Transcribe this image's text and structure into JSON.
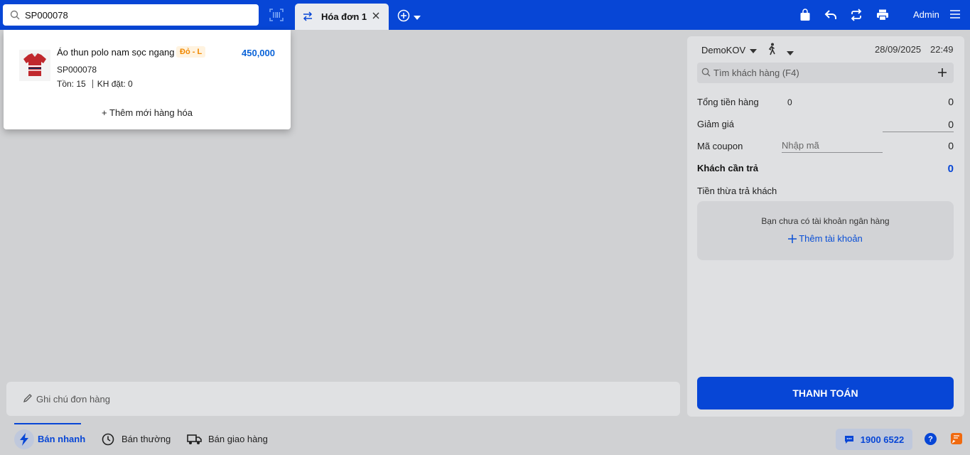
{
  "search": {
    "value": "SP000078"
  },
  "tabs": [
    {
      "label": "Hóa đơn 1"
    }
  ],
  "header": {
    "user": "Admin"
  },
  "dropdown": {
    "product": {
      "name": "Áo thun polo nam sọc ngang",
      "variant": "Đỏ - L",
      "price": "450,000",
      "sku": "SP000078",
      "stock_label": "Tồn: 15",
      "ordered_label": "KH đặt: 0"
    },
    "add_new": "+ Thêm mới hàng hóa"
  },
  "note": {
    "placeholder": "Ghi chú đơn hàng"
  },
  "panel": {
    "store": "DemoKOV",
    "date": "28/09/2025",
    "time": "22:49",
    "customer_search_placeholder": "Tìm khách hàng (F4)",
    "total_label": "Tổng tiền hàng",
    "total_qty": "0",
    "total_value": "0",
    "discount_label": "Giảm giá",
    "discount_value": "0",
    "coupon_label": "Mã coupon",
    "coupon_placeholder": "Nhập mã",
    "coupon_value": "0",
    "due_label": "Khách cần trả",
    "due_value": "0",
    "change_label": "Tiền thừa trả khách",
    "bank_msg": "Bạn chưa có tài khoản ngân hàng",
    "bank_add": "Thêm tài khoản",
    "pay_button": "THANH TOÁN"
  },
  "bottom": {
    "modes": [
      {
        "label": "Bán nhanh"
      },
      {
        "label": "Bán thường"
      },
      {
        "label": "Bán giao hàng"
      }
    ],
    "hotline": "1900 6522",
    "help": "?"
  },
  "colors": {
    "brand": "#0746d6",
    "price": "#0a63d8",
    "variant": "#f08800",
    "feedback": "#f06a0f"
  }
}
